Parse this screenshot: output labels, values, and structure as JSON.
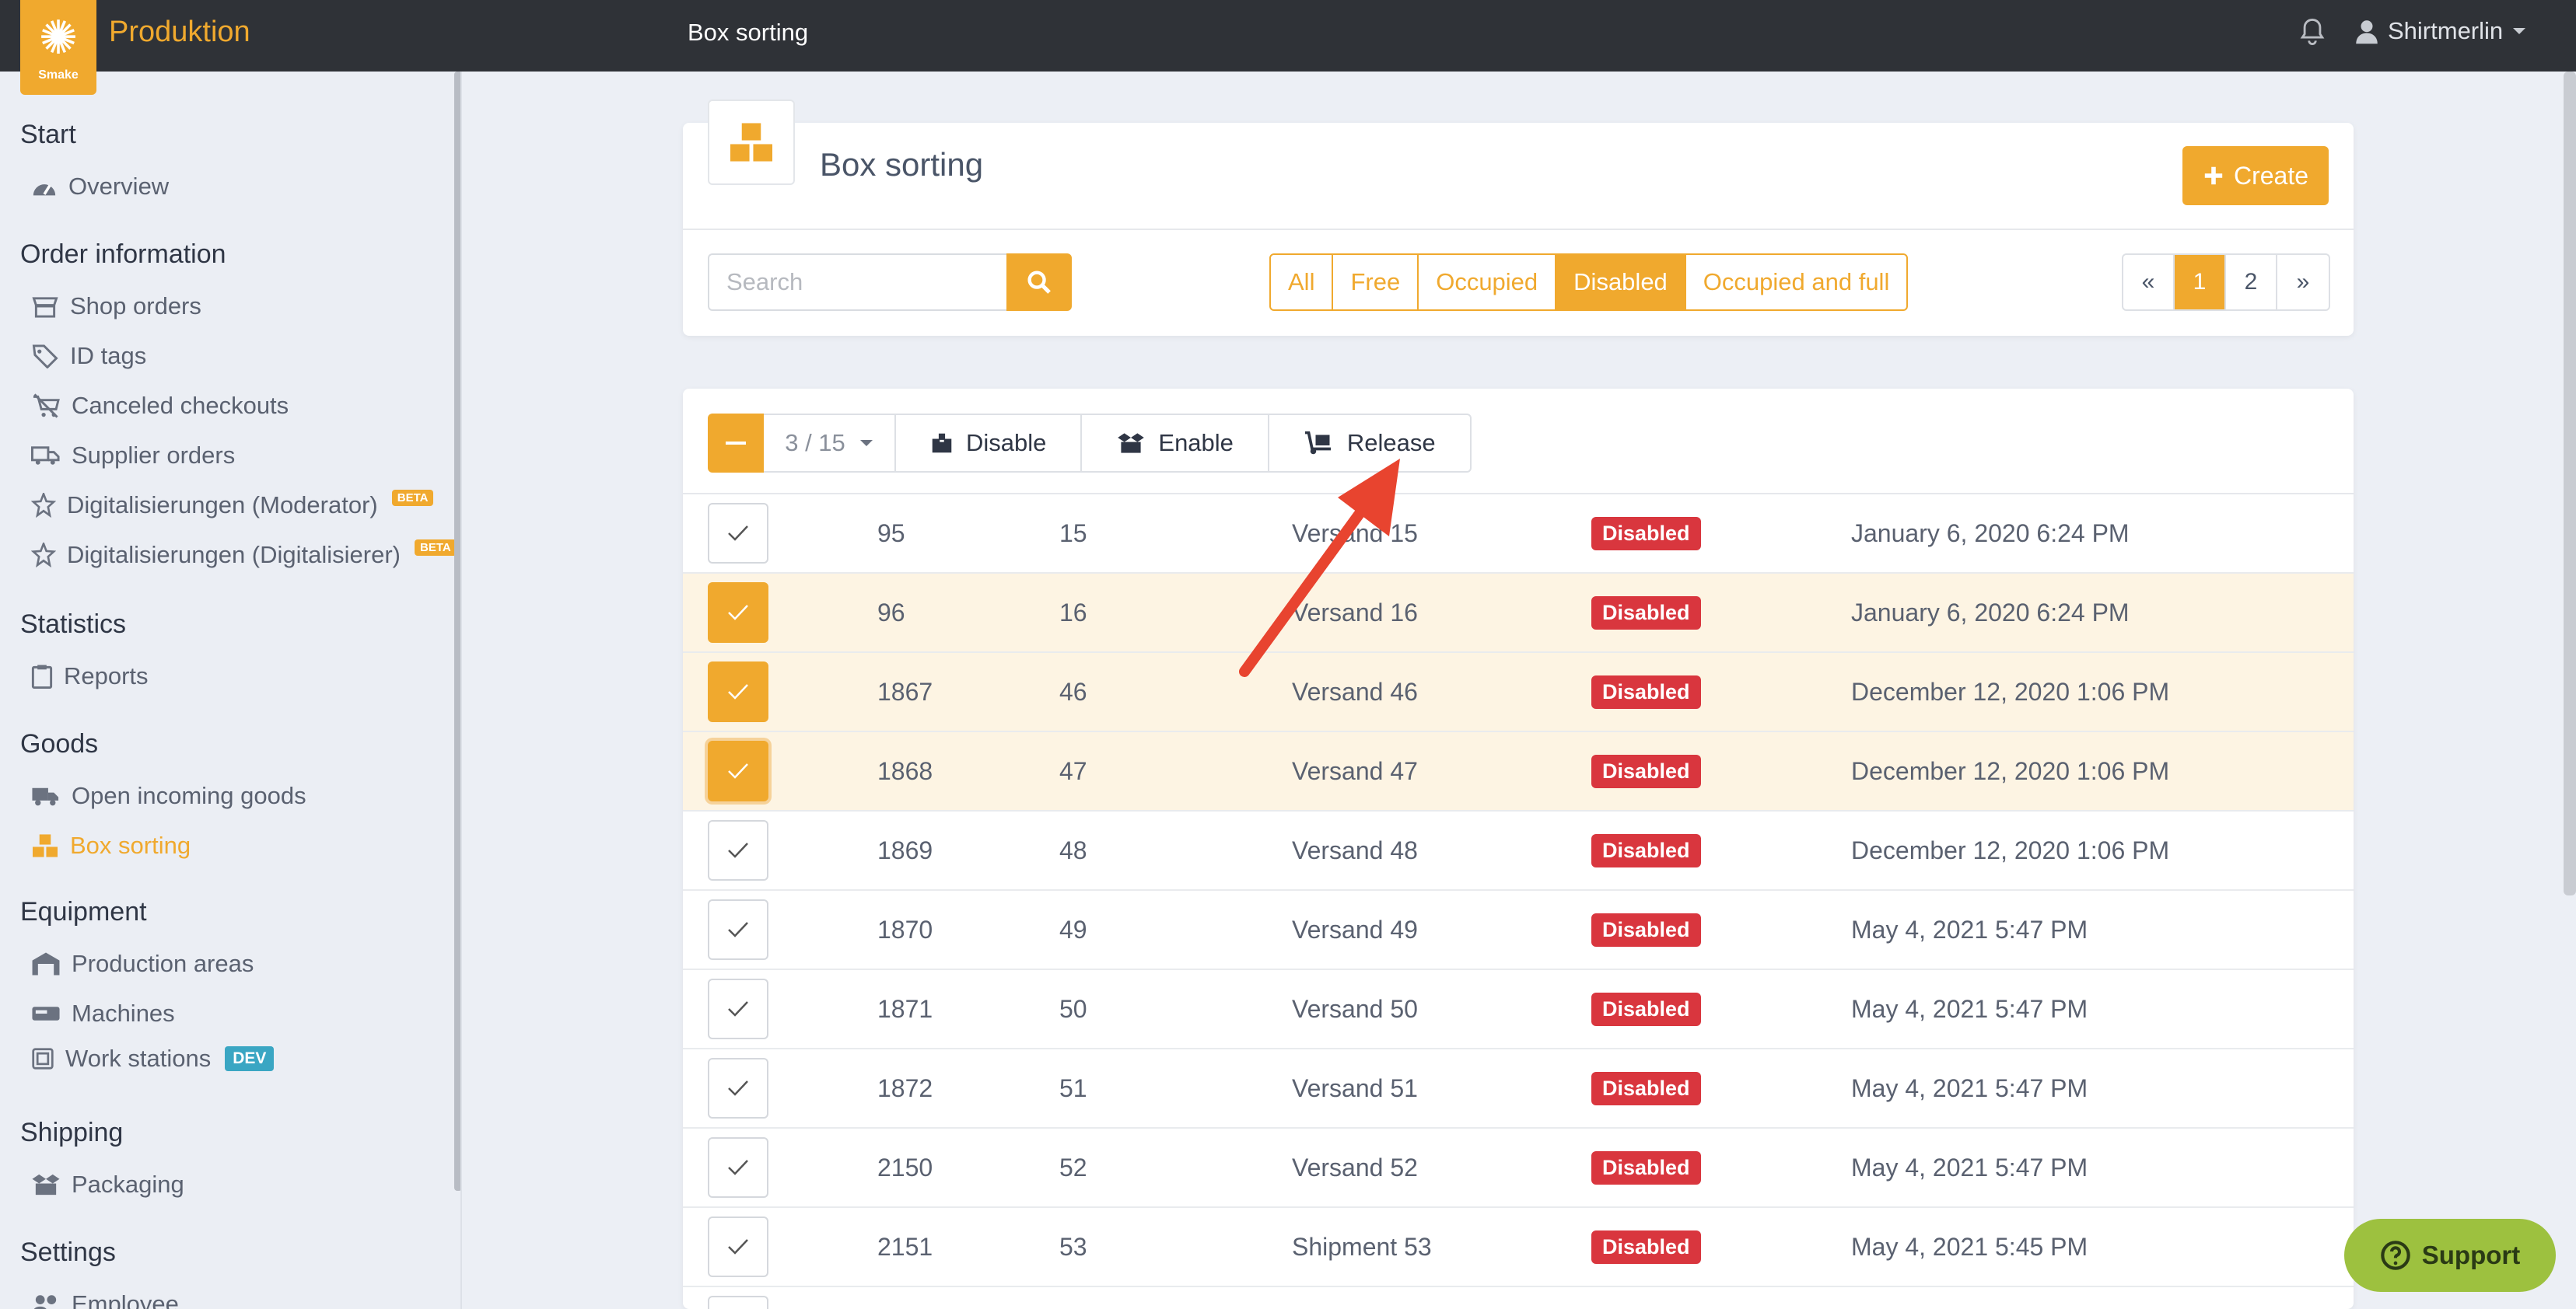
{
  "topbar": {
    "logo_text": "Smake",
    "app_title": "Produktion",
    "page_title": "Box sorting",
    "user_name": "Shirtmerlin"
  },
  "sidebar": {
    "sections": [
      {
        "title": "Start",
        "items": [
          {
            "label": "Overview",
            "icon": "gauge-icon"
          }
        ]
      },
      {
        "title": "Order information",
        "items": [
          {
            "label": "Shop orders",
            "icon": "shop-icon"
          },
          {
            "label": "ID tags",
            "icon": "tag-icon"
          },
          {
            "label": "Canceled checkouts",
            "icon": "cart-slash-icon"
          },
          {
            "label": "Supplier orders",
            "icon": "truck-icon"
          },
          {
            "label": "Digitalisierungen (Moderator)",
            "icon": "magic-icon",
            "badge": "BETA"
          },
          {
            "label": "Digitalisierungen (Digitalisierer)",
            "icon": "magic-icon",
            "badge": "BETA"
          }
        ]
      },
      {
        "title": "Statistics",
        "items": [
          {
            "label": "Reports",
            "icon": "clipboard-icon"
          }
        ]
      },
      {
        "title": "Goods",
        "items": [
          {
            "label": "Open incoming goods",
            "icon": "truck-icon"
          },
          {
            "label": "Box sorting",
            "icon": "boxes-icon",
            "active": true
          }
        ]
      },
      {
        "title": "Equipment",
        "items": [
          {
            "label": "Production areas",
            "icon": "warehouse-icon"
          },
          {
            "label": "Machines",
            "icon": "machine-icon"
          },
          {
            "label": "Work stations",
            "icon": "workstation-icon",
            "badge": "DEV"
          }
        ]
      },
      {
        "title": "Shipping",
        "items": [
          {
            "label": "Packaging",
            "icon": "box-open-icon"
          }
        ]
      },
      {
        "title": "Settings",
        "items": [
          {
            "label": "Employee",
            "icon": "users-icon"
          }
        ]
      }
    ]
  },
  "header": {
    "title": "Box sorting",
    "create_label": "Create"
  },
  "search": {
    "placeholder": "Search"
  },
  "filters": [
    {
      "label": "All",
      "active": false
    },
    {
      "label": "Free",
      "active": false
    },
    {
      "label": "Occupied",
      "active": false
    },
    {
      "label": "Disabled",
      "active": true
    },
    {
      "label": "Occupied and full",
      "active": false
    }
  ],
  "pagination": {
    "prev": "«",
    "pages": [
      "1",
      "2"
    ],
    "current": "1",
    "next": "»"
  },
  "bulk": {
    "selection": "3 / 15",
    "disable_label": "Disable",
    "enable_label": "Enable",
    "release_label": "Release"
  },
  "rows": [
    {
      "id": "95",
      "number": "15",
      "name": "Versand 15",
      "status": "Disabled",
      "date": "January 6, 2020 6:24 PM",
      "selected": false
    },
    {
      "id": "96",
      "number": "16",
      "name": "Versand 16",
      "status": "Disabled",
      "date": "January 6, 2020 6:24 PM",
      "selected": true
    },
    {
      "id": "1867",
      "number": "46",
      "name": "Versand 46",
      "status": "Disabled",
      "date": "December 12, 2020 1:06 PM",
      "selected": true
    },
    {
      "id": "1868",
      "number": "47",
      "name": "Versand 47",
      "status": "Disabled",
      "date": "December 12, 2020 1:06 PM",
      "selected": true
    },
    {
      "id": "1869",
      "number": "48",
      "name": "Versand 48",
      "status": "Disabled",
      "date": "December 12, 2020 1:06 PM",
      "selected": false
    },
    {
      "id": "1870",
      "number": "49",
      "name": "Versand 49",
      "status": "Disabled",
      "date": "May 4, 2021 5:47 PM",
      "selected": false
    },
    {
      "id": "1871",
      "number": "50",
      "name": "Versand 50",
      "status": "Disabled",
      "date": "May 4, 2021 5:47 PM",
      "selected": false
    },
    {
      "id": "1872",
      "number": "51",
      "name": "Versand 51",
      "status": "Disabled",
      "date": "May 4, 2021 5:47 PM",
      "selected": false
    },
    {
      "id": "2150",
      "number": "52",
      "name": "Versand 52",
      "status": "Disabled",
      "date": "May 4, 2021 5:47 PM",
      "selected": false
    },
    {
      "id": "2151",
      "number": "53",
      "name": "Shipment 53",
      "status": "Disabled",
      "date": "May 4, 2021 5:45 PM",
      "selected": false
    }
  ],
  "support_label": "Support",
  "colors": {
    "accent": "#f0a92e",
    "danger": "#d9363e",
    "topbar": "#2f3237",
    "support": "#9dc13f",
    "annotation": "#e8442f"
  }
}
